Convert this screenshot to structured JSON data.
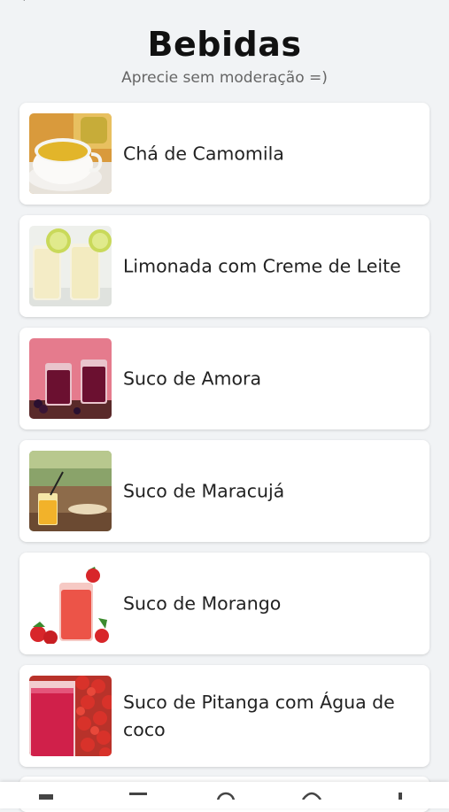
{
  "header": {
    "title": "Bebidas",
    "subtitle": "Aprecie sem moderação =)"
  },
  "drinks": [
    {
      "label": "Chá de Camomila",
      "image": "chamomile-tea-image"
    },
    {
      "label": "Limonada com Creme de Leite",
      "image": "creamy-lemonade-image"
    },
    {
      "label": "Suco de Amora",
      "image": "blackberry-juice-image"
    },
    {
      "label": "Suco de Maracujá",
      "image": "passion-fruit-juice-image"
    },
    {
      "label": "Suco de Morango",
      "image": "strawberry-juice-image"
    },
    {
      "label": "Suco de Pitanga com  Água de coco",
      "image": "pitanga-juice-image"
    }
  ],
  "colors": {
    "background": "#f1f3f5",
    "card": "#ffffff",
    "title": "#111111",
    "subtitle": "#666666"
  }
}
